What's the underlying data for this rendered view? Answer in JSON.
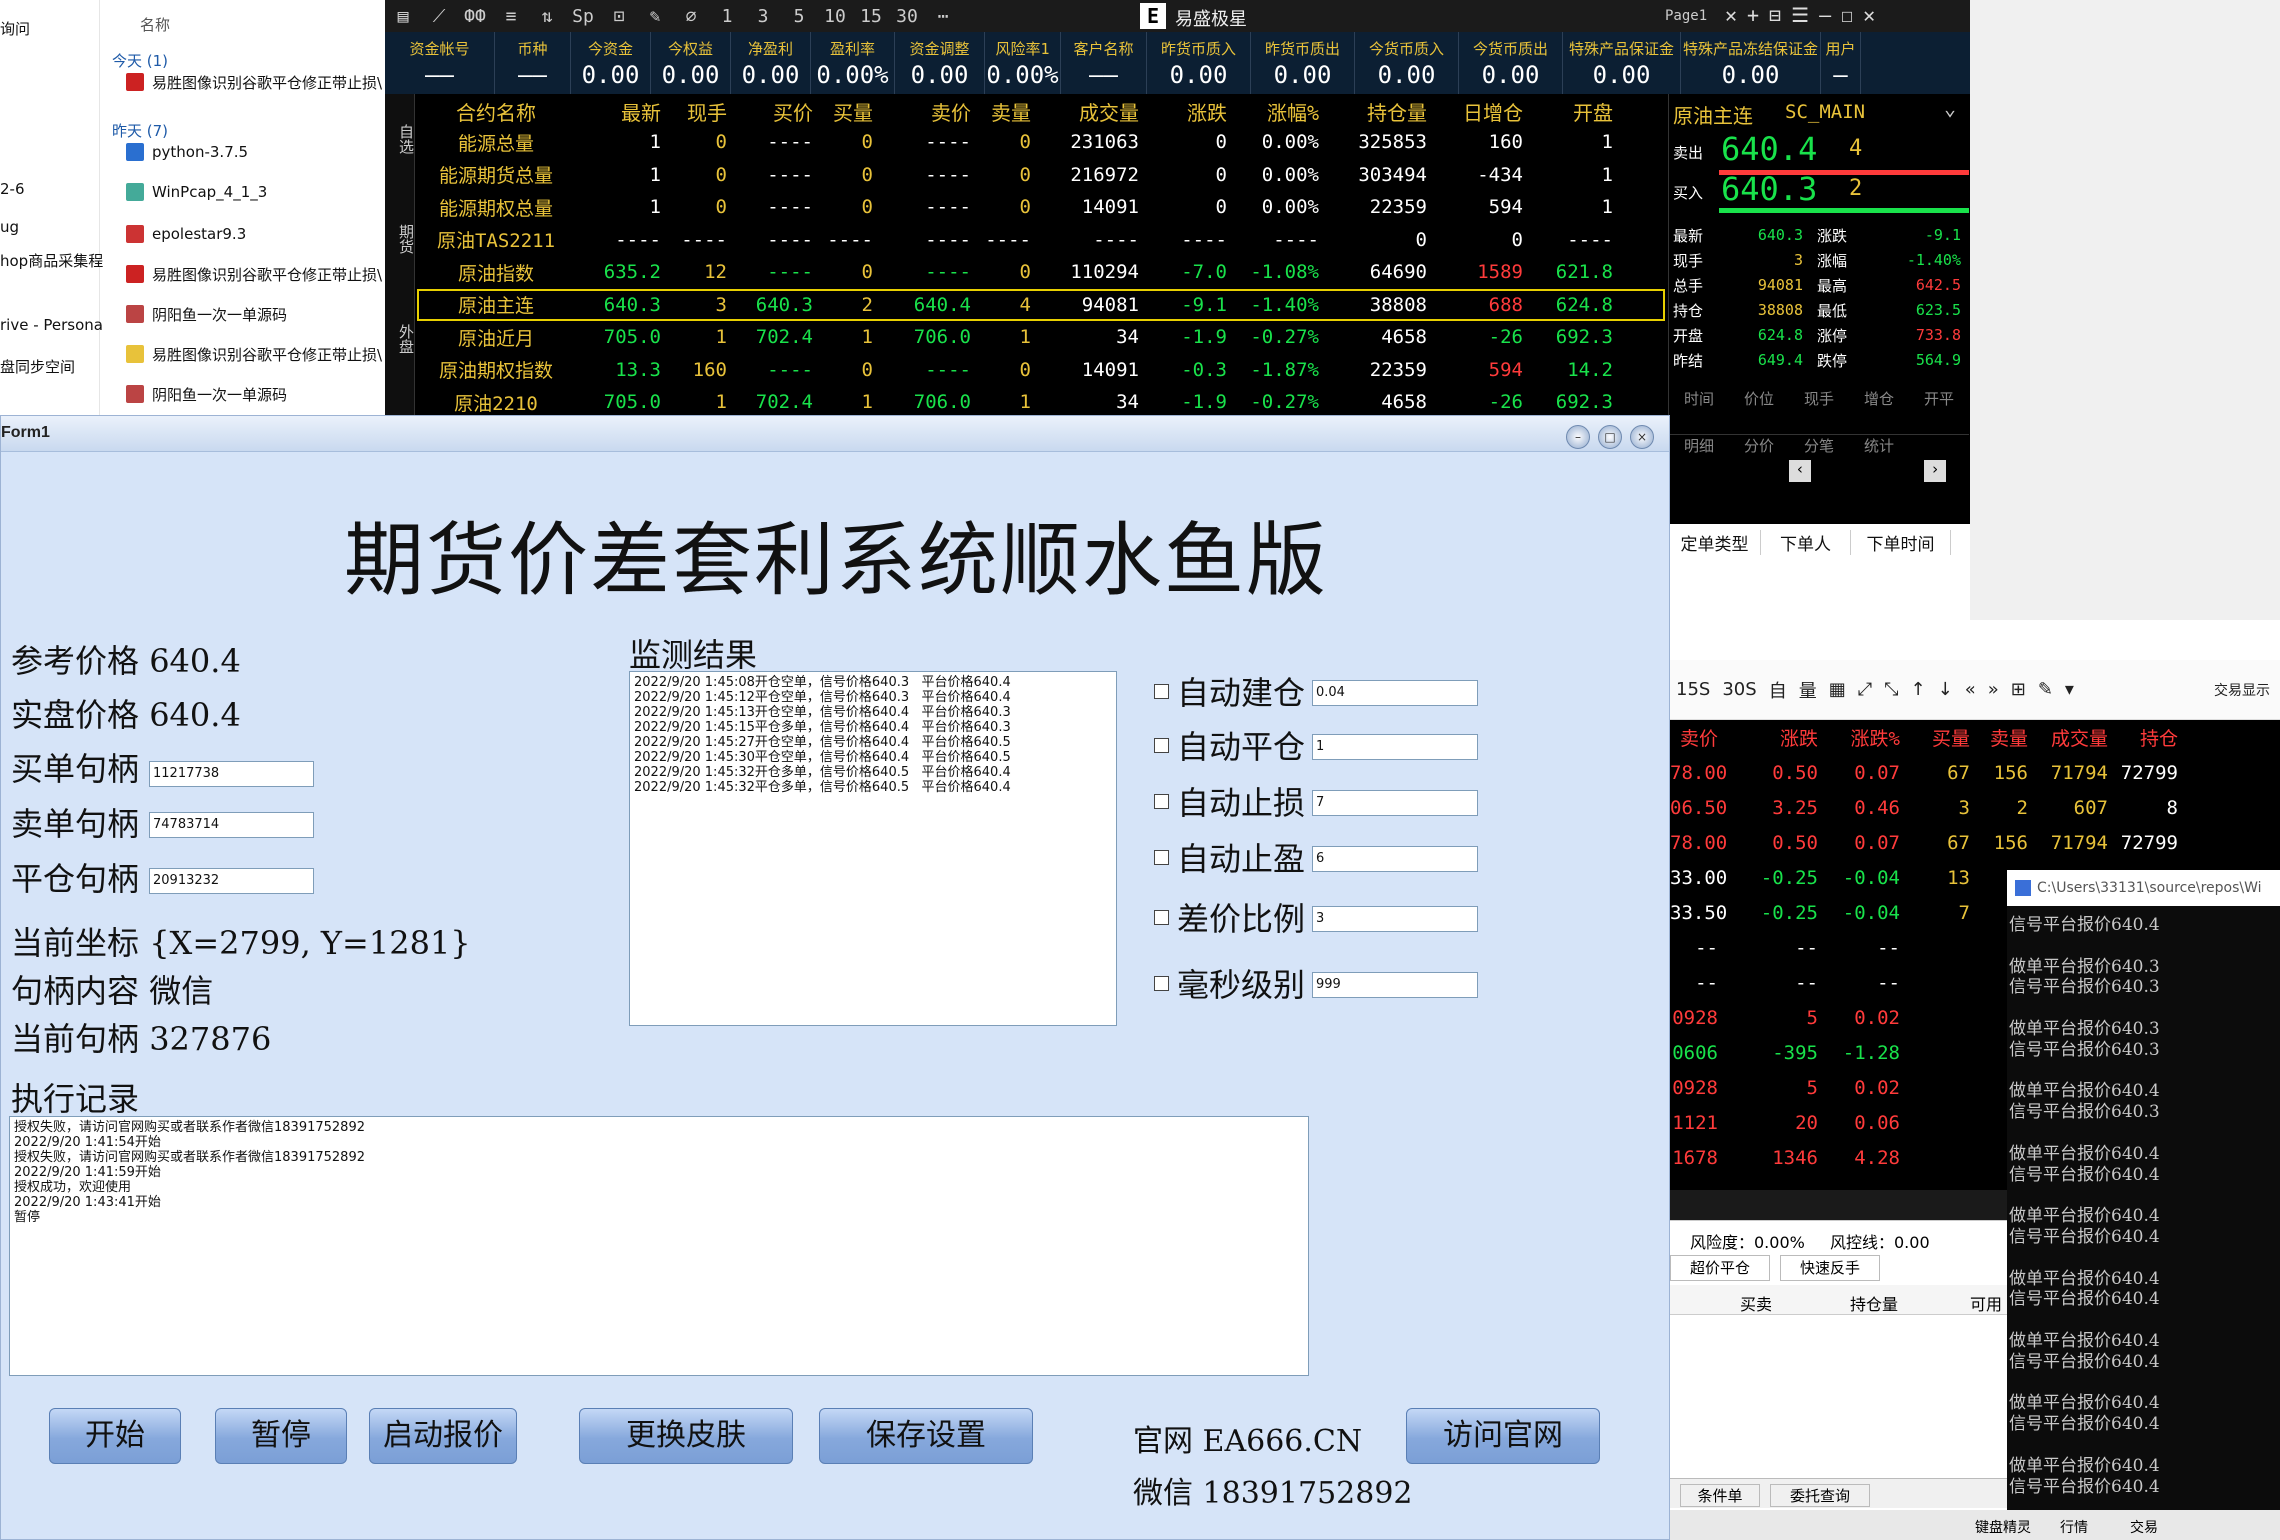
{
  "explorer": {
    "column_header": "名称",
    "nav_items": [
      "询问",
      "2-6",
      "ug",
      "hop商品采集程",
      "rive - Persona",
      "盘同步空间"
    ],
    "groups": [
      "今天 (1)",
      "昨天 (7)"
    ],
    "files": [
      "易胜图像识别谷歌平仓修正带止损\\",
      "python-3.7.5",
      "WinPcap_4_1_3",
      "epolestar9.3",
      "易胜图像识别谷歌平仓修正带止损\\",
      "阴阳鱼一次一单源码",
      "易胜图像识别谷歌平仓修正带止损\\",
      "阴阳鱼一次一单源码"
    ]
  },
  "trade": {
    "app_title": "易盛极星",
    "app_logo": "E",
    "toolbar_icons": [
      "▤",
      "⟋",
      "ФФ",
      "≡",
      "⇅",
      "Sp",
      "⊡",
      "✎",
      "⌀",
      "1",
      "3",
      "5",
      "10",
      "15",
      "30",
      "⋯"
    ],
    "page_tab": "Page1",
    "window_controls": [
      "✕",
      "+",
      "⊟",
      "☰",
      "—",
      "☐",
      "✕"
    ],
    "account_fields": [
      {
        "label": "资金帐号",
        "value": "——"
      },
      {
        "label": "币种",
        "value": "——"
      },
      {
        "label": "今资金",
        "value": "0.00"
      },
      {
        "label": "今权益",
        "value": "0.00"
      },
      {
        "label": "净盈利",
        "value": "0.00"
      },
      {
        "label": "盈利率",
        "value": "0.00%"
      },
      {
        "label": "资金调整",
        "value": "0.00"
      },
      {
        "label": "风险率1",
        "value": "0.00%"
      },
      {
        "label": "客户名称",
        "value": "——"
      },
      {
        "label": "昨货币质入",
        "value": "0.00"
      },
      {
        "label": "昨货币质出",
        "value": "0.00"
      },
      {
        "label": "今货币质入",
        "value": "0.00"
      },
      {
        "label": "今货币质出",
        "value": "0.00"
      },
      {
        "label": "特殊产品保证金",
        "value": "0.00"
      },
      {
        "label": "特殊产品冻结保证金",
        "value": "0.00"
      },
      {
        "label": "用户",
        "value": "—"
      }
    ],
    "side_tabs": [
      "自选",
      "期货",
      "外盘"
    ],
    "quote_headers": [
      "合约名称",
      "最新",
      "现手",
      "买价",
      "买量",
      "卖价",
      "卖量",
      "成交量",
      "涨跌",
      "涨幅%",
      "持仓量",
      "日增仓",
      "开盘"
    ],
    "quotes": [
      [
        "能源总量",
        "1",
        "0",
        "----",
        "0",
        "----",
        "0",
        "231063",
        "0",
        "0.00%",
        "325853",
        "160",
        "1"
      ],
      [
        "能源期货总量",
        "1",
        "0",
        "----",
        "0",
        "----",
        "0",
        "216972",
        "0",
        "0.00%",
        "303494",
        "-434",
        "1"
      ],
      [
        "能源期权总量",
        "1",
        "0",
        "----",
        "0",
        "----",
        "0",
        "14091",
        "0",
        "0.00%",
        "22359",
        "594",
        "1"
      ],
      [
        "原油TAS2211",
        "----",
        "----",
        "----",
        "----",
        "----",
        "----",
        "----",
        "----",
        "----",
        "0",
        "0",
        "----"
      ],
      [
        "原油指数",
        "635.2",
        "12",
        "----",
        "0",
        "----",
        "0",
        "110294",
        "-7.0",
        "-1.08%",
        "64690",
        "1589",
        "621.8"
      ],
      [
        "原油主连",
        "640.3",
        "3",
        "640.3",
        "2",
        "640.4",
        "4",
        "94081",
        "-9.1",
        "-1.40%",
        "38808",
        "688",
        "624.8"
      ],
      [
        "原油近月",
        "705.0",
        "1",
        "702.4",
        "1",
        "706.0",
        "1",
        "34",
        "-1.9",
        "-0.27%",
        "4658",
        "-26",
        "692.3"
      ],
      [
        "原油期权指数",
        "13.3",
        "160",
        "----",
        "0",
        "----",
        "0",
        "14091",
        "-0.3",
        "-1.87%",
        "22359",
        "594",
        "14.2"
      ],
      [
        "原油2210",
        "705.0",
        "1",
        "702.4",
        "1",
        "706.0",
        "1",
        "34",
        "-1.9",
        "-0.27%",
        "4658",
        "-26",
        "692.3"
      ]
    ],
    "detail": {
      "title": "原油主连",
      "code": "SC_MAIN",
      "sell_label": "卖出",
      "sell_price": "640.4",
      "sell_qty": "4",
      "buy_label": "买入",
      "buy_price": "640.3",
      "buy_qty": "2",
      "stats": [
        [
          "最新",
          "640.3",
          "涨跌",
          "-9.1"
        ],
        [
          "现手",
          "3",
          "涨幅",
          "-1.40%"
        ],
        [
          "总手",
          "94081",
          "最高",
          "642.5"
        ],
        [
          "持仓",
          "38808",
          "最低",
          "623.5"
        ],
        [
          "开盘",
          "624.8",
          "涨停",
          "733.8"
        ],
        [
          "昨结",
          "649.4",
          "跌停",
          "564.9"
        ]
      ],
      "tick_headers": [
        "时间",
        "价位",
        "现手",
        "增仓",
        "开平"
      ],
      "bottom_tabs": [
        "明细",
        "分价",
        "分笔",
        "统计"
      ],
      "order_headers": [
        "定单类型",
        "下单人",
        "下单时间"
      ]
    }
  },
  "form": {
    "window_title": "Form1",
    "title": "期货价差套利系统顺水鱼版",
    "ref_price_label": "参考价格",
    "ref_price": "640.4",
    "real_price_label": "实盘价格",
    "real_price": "640.4",
    "buy_handle_label": "买单句柄",
    "buy_handle": "11217738",
    "sell_handle_label": "卖单句柄",
    "sell_handle": "74783714",
    "close_handle_label": "平仓句柄",
    "close_handle": "20913232",
    "coord_label": "当前坐标",
    "coord": "{X=2799, Y=1281}",
    "handle_content_label": "句柄内容",
    "handle_content": "微信",
    "cur_handle_label": "当前句柄",
    "cur_handle": "327876",
    "monitor_label": "监测结果",
    "monitor_lines": [
      "2022/9/20 1:45:08开仓空单，信号价格640.3   平台价格640.4",
      "2022/9/20 1:45:12平仓空单，信号价格640.3   平台价格640.4",
      "2022/9/20 1:45:13开仓空单，信号价格640.4   平台价格640.3",
      "2022/9/20 1:45:15平仓多单，信号价格640.4   平台价格640.3",
      "2022/9/20 1:45:27开仓空单，信号价格640.4   平台价格640.5",
      "2022/9/20 1:45:30平仓空单，信号价格640.4   平台价格640.5",
      "2022/9/20 1:45:32开仓多单，信号价格640.5   平台价格640.4",
      "2022/9/20 1:45:32平仓多单，信号价格640.5   平台价格640.4"
    ],
    "log_label": "执行记录",
    "log_lines": [
      "授权失败，请访问官网购买或者联系作者微信18391752892",
      "2022/9/20 1:41:54开始",
      "授权失败，请访问官网购买或者联系作者微信18391752892",
      "2022/9/20 1:41:59开始",
      "授权成功，欢迎使用",
      "2022/9/20 1:43:41开始",
      "暂停"
    ],
    "options": [
      {
        "label": "自动建仓",
        "value": "0.04"
      },
      {
        "label": "自动平仓",
        "value": "1"
      },
      {
        "label": "自动止损",
        "value": "7"
      },
      {
        "label": "自动止盈",
        "value": "6"
      },
      {
        "label": "差价比例",
        "value": "3"
      },
      {
        "label": "毫秒级别",
        "value": "999"
      }
    ],
    "buttons": [
      "开始",
      "暂停",
      "启动报价",
      "更换皮肤",
      "保存设置",
      "访问官网"
    ],
    "site_label": "官网",
    "site": "EA666.CN",
    "wechat_label": "微信",
    "wechat": "18391752892"
  },
  "lower": {
    "toolbar": [
      "15S",
      "30S",
      "自",
      "量",
      "▦",
      "⤢",
      "⤡",
      "↑",
      "↓",
      "«",
      "»",
      "⊞",
      "✎",
      "▾"
    ],
    "toolbar_right": "交易显示",
    "headers": [
      "卖价",
      "涨跌",
      "涨跌%",
      "买量",
      "卖量",
      "成交量",
      "持仓"
    ],
    "rows": [
      [
        "78.00",
        "0.50",
        "0.07",
        "67",
        "156",
        "71794",
        "72799"
      ],
      [
        "06.50",
        "3.25",
        "0.46",
        "3",
        "2",
        "607",
        "8"
      ],
      [
        "78.00",
        "0.50",
        "0.07",
        "67",
        "156",
        "71794",
        "72799"
      ],
      [
        "33.00",
        "-0.25",
        "-0.04",
        "13",
        "",
        "",
        ""
      ],
      [
        "33.50",
        "-0.25",
        "-0.04",
        "7",
        "",
        "",
        ""
      ],
      [
        "--",
        "--",
        "--",
        "",
        "",
        "",
        ""
      ],
      [
        "--",
        "--",
        "--",
        "",
        "",
        "",
        ""
      ],
      [
        "0928",
        "5",
        "0.02",
        "",
        "",
        "",
        ""
      ],
      [
        "0606",
        "-395",
        "-1.28",
        "",
        "",
        "",
        ""
      ],
      [
        "0928",
        "5",
        "0.02",
        "",
        "",
        "",
        ""
      ],
      [
        "1121",
        "20",
        "0.06",
        "",
        "",
        "",
        ""
      ],
      [
        "1678",
        "1346",
        "4.28",
        "",
        "",
        "",
        ""
      ]
    ],
    "risk_label": "风险度：0.00%",
    "riskline_label": "风控线：0.00",
    "btn1": "超价平仓",
    "btn2": "快速反手",
    "pos_headers": [
      "买卖",
      "持仓量",
      "可用"
    ],
    "bottom_tabs": [
      "条件单",
      "委托查询"
    ],
    "status_items": [
      "键盘精灵",
      "行情",
      "交易"
    ]
  },
  "console": {
    "title": "C:\\Users\\33131\\source\\repos\\Wi",
    "lines": [
      "信号平台报价640.4",
      "",
      "做单平台报价640.3",
      "信号平台报价640.3",
      "",
      "做单平台报价640.3",
      "信号平台报价640.3",
      "",
      "做单平台报价640.4",
      "信号平台报价640.3",
      "",
      "做单平台报价640.4",
      "信号平台报价640.4",
      "",
      "做单平台报价640.4",
      "信号平台报价640.4",
      "",
      "做单平台报价640.4",
      "信号平台报价640.4",
      "",
      "做单平台报价640.4",
      "信号平台报价640.4",
      "",
      "做单平台报价640.4",
      "信号平台报价640.4",
      "",
      "做单平台报价640.4",
      "信号平台报价640.4"
    ]
  },
  "colors": {
    "up": "#ff3b3b",
    "down": "#19e24b",
    "label": "#e8c23a",
    "form_bg": "#d6e4f8",
    "highlight_border": "#e8d000"
  }
}
